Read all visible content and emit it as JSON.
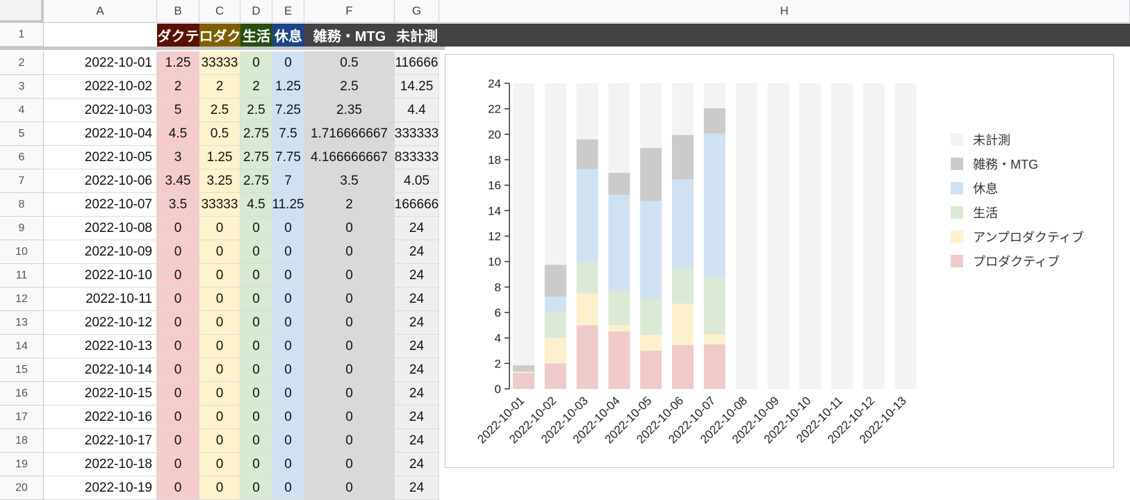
{
  "columns": [
    "A",
    "B",
    "C",
    "D",
    "E",
    "F",
    "G",
    "H"
  ],
  "header_row": {
    "row_number": "1",
    "cells": [
      "",
      "ダクテ",
      "ロダク",
      "生活",
      "休息",
      "雑務・MTG",
      "未計測"
    ],
    "colors": [
      "#ffffff",
      "#5b0f00",
      "#7f6000",
      "#274e13",
      "#1c4587",
      "#434343",
      "#434343"
    ]
  },
  "column_fills": [
    "#ffffff",
    "#f4cccc",
    "#fff2cc",
    "#d9ead3",
    "#cfe2f3",
    "#d9d9d9",
    "#efefef"
  ],
  "rows": [
    {
      "n": "2",
      "cells": [
        "2022-10-01",
        "1.25",
        "33333",
        "0",
        "0",
        "0.5",
        "116666"
      ]
    },
    {
      "n": "3",
      "cells": [
        "2022-10-02",
        "2",
        "2",
        "2",
        "1.25",
        "2.5",
        "14.25"
      ]
    },
    {
      "n": "4",
      "cells": [
        "2022-10-03",
        "5",
        "2.5",
        "2.5",
        "7.25",
        "2.35",
        "4.4"
      ]
    },
    {
      "n": "5",
      "cells": [
        "2022-10-04",
        "4.5",
        "0.5",
        "2.75",
        "7.5",
        "1.716666667",
        "333333"
      ]
    },
    {
      "n": "6",
      "cells": [
        "2022-10-05",
        "3",
        "1.25",
        "2.75",
        "7.75",
        "4.166666667",
        "833333"
      ]
    },
    {
      "n": "7",
      "cells": [
        "2022-10-06",
        "3.45",
        "3.25",
        "2.75",
        "7",
        "3.5",
        "4.05"
      ]
    },
    {
      "n": "8",
      "cells": [
        "2022-10-07",
        "3.5",
        "33333",
        "4.5",
        "11.25",
        "2",
        "166666"
      ]
    },
    {
      "n": "9",
      "cells": [
        "2022-10-08",
        "0",
        "0",
        "0",
        "0",
        "0",
        "24"
      ]
    },
    {
      "n": "10",
      "cells": [
        "2022-10-09",
        "0",
        "0",
        "0",
        "0",
        "0",
        "24"
      ]
    },
    {
      "n": "11",
      "cells": [
        "2022-10-10",
        "0",
        "0",
        "0",
        "0",
        "0",
        "24"
      ]
    },
    {
      "n": "12",
      "cells": [
        "2022-10-11",
        "0",
        "0",
        "0",
        "0",
        "0",
        "24"
      ]
    },
    {
      "n": "13",
      "cells": [
        "2022-10-12",
        "0",
        "0",
        "0",
        "0",
        "0",
        "24"
      ]
    },
    {
      "n": "14",
      "cells": [
        "2022-10-13",
        "0",
        "0",
        "0",
        "0",
        "0",
        "24"
      ]
    },
    {
      "n": "15",
      "cells": [
        "2022-10-14",
        "0",
        "0",
        "0",
        "0",
        "0",
        "24"
      ]
    },
    {
      "n": "16",
      "cells": [
        "2022-10-15",
        "0",
        "0",
        "0",
        "0",
        "0",
        "24"
      ]
    },
    {
      "n": "17",
      "cells": [
        "2022-10-16",
        "0",
        "0",
        "0",
        "0",
        "0",
        "24"
      ]
    },
    {
      "n": "18",
      "cells": [
        "2022-10-17",
        "0",
        "0",
        "0",
        "0",
        "0",
        "24"
      ]
    },
    {
      "n": "19",
      "cells": [
        "2022-10-18",
        "0",
        "0",
        "0",
        "0",
        "0",
        "24"
      ]
    },
    {
      "n": "20",
      "cells": [
        "2022-10-19",
        "0",
        "0",
        "0",
        "0",
        "0",
        "24"
      ]
    }
  ],
  "chart_data": {
    "type": "bar",
    "stacked": true,
    "categories": [
      "2022-10-01",
      "2022-10-02",
      "2022-10-03",
      "2022-10-04",
      "2022-10-05",
      "2022-10-06",
      "2022-10-07",
      "2022-10-08",
      "2022-10-09",
      "2022-10-10",
      "2022-10-11",
      "2022-10-12",
      "2022-10-13"
    ],
    "series": [
      {
        "name": "プロダクティブ",
        "color": "#efcacb",
        "values": [
          1.25,
          2,
          5,
          4.5,
          3,
          3.45,
          3.5,
          0,
          0,
          0,
          0,
          0,
          0
        ]
      },
      {
        "name": "アンプロダクティブ",
        "color": "#fdf0cc",
        "values": [
          0.1,
          2,
          2.5,
          0.5,
          1.25,
          3.25,
          0.8,
          0,
          0,
          0,
          0,
          0,
          0
        ]
      },
      {
        "name": "生活",
        "color": "#dbe9d5",
        "values": [
          0,
          2,
          2.5,
          2.75,
          2.75,
          2.75,
          4.5,
          0,
          0,
          0,
          0,
          0,
          0
        ]
      },
      {
        "name": "休息",
        "color": "#d0e1f1",
        "values": [
          0,
          1.25,
          7.25,
          7.5,
          7.75,
          7,
          11.25,
          0,
          0,
          0,
          0,
          0,
          0
        ]
      },
      {
        "name": "雑務・MTG",
        "color": "#cbcbcb",
        "values": [
          0.5,
          2.5,
          2.35,
          1.72,
          4.17,
          3.5,
          2,
          0,
          0,
          0,
          0,
          0,
          0
        ]
      },
      {
        "name": "未計測",
        "color": "#f3f3f3",
        "values": [
          22.15,
          14.25,
          4.4,
          7.03,
          5.08,
          4.05,
          1.95,
          24,
          24,
          24,
          24,
          24,
          24
        ]
      }
    ],
    "yticks": [
      "0",
      "2",
      "4",
      "6",
      "8",
      "10",
      "12",
      "14",
      "16",
      "18",
      "20",
      "22",
      "24"
    ],
    "ylim": [
      0,
      24
    ],
    "legend_position": "right",
    "legend_order": [
      "未計測",
      "雑務・MTG",
      "休息",
      "生活",
      "アンプロダクティブ",
      "プロダクティブ"
    ]
  }
}
